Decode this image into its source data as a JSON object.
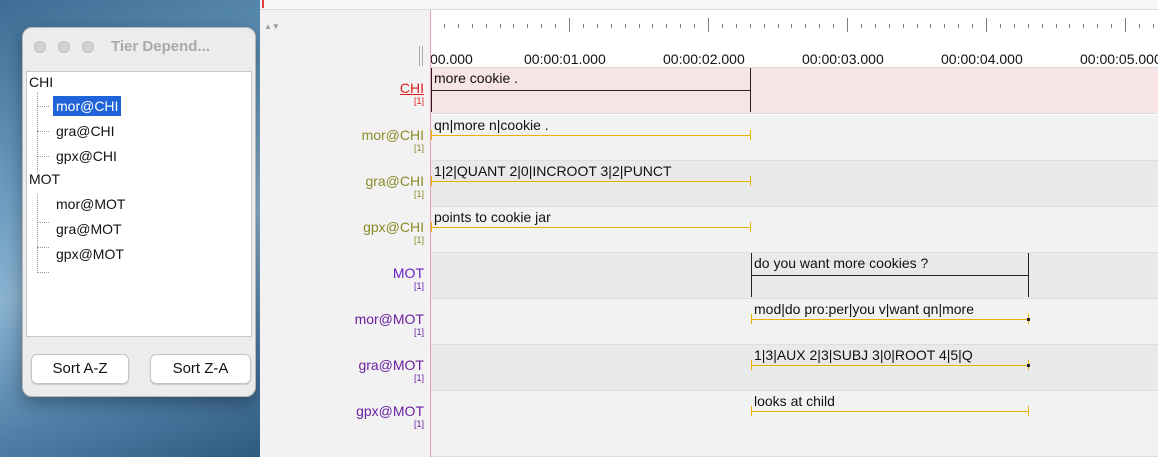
{
  "tier_dependency_window": {
    "title": "Tier Depend...",
    "tree": [
      {
        "label": "CHI",
        "level": 0,
        "selected": false
      },
      {
        "label": "mor@CHI",
        "level": 1,
        "selected": true
      },
      {
        "label": "gra@CHI",
        "level": 1,
        "selected": false
      },
      {
        "label": "gpx@CHI",
        "level": 1,
        "selected": false
      },
      {
        "label": "MOT",
        "level": 0,
        "selected": false
      },
      {
        "label": "mor@MOT",
        "level": 1,
        "selected": false
      },
      {
        "label": "gra@MOT",
        "level": 1,
        "selected": false
      },
      {
        "label": "gpx@MOT",
        "level": 1,
        "selected": false
      }
    ],
    "sort_az_label": "Sort A-Z",
    "sort_za_label": "Sort Z-A"
  },
  "timeline": {
    "ticks": [
      "00.000",
      "00:00:01.000",
      "00:00:02.000",
      "00:00:03.000",
      "00:00:04.000",
      "00:00:05.000"
    ]
  },
  "tiers": [
    {
      "name": "CHI",
      "index": "[1]",
      "color": "#e02020",
      "segments": [
        {
          "text": "more cookie ."
        }
      ]
    },
    {
      "name": "mor@CHI",
      "index": "[1]",
      "color": "#8a8a2a",
      "segments": [
        {
          "text": "qn|more n|cookie ."
        }
      ]
    },
    {
      "name": "gra@CHI",
      "index": "[1]",
      "color": "#8a8a2a",
      "segments": [
        {
          "text": "1|2|QUANT 2|0|INCROOT 3|2|PUNCT"
        }
      ]
    },
    {
      "name": "gpx@CHI",
      "index": "[1]",
      "color": "#8a8a2a",
      "segments": [
        {
          "text": "points to cookie jar"
        }
      ]
    },
    {
      "name": "MOT",
      "index": "[1]",
      "color": "#6a20c0",
      "segments": [
        {
          "text": "do you want more cookies ?"
        }
      ]
    },
    {
      "name": "mor@MOT",
      "index": "[1]",
      "color": "#6a20a0",
      "segments": [
        {
          "text": "mod|do pro:per|you v|want qn|more"
        }
      ]
    },
    {
      "name": "gra@MOT",
      "index": "[1]",
      "color": "#6a20a0",
      "segments": [
        {
          "text": "1|3|AUX 2|3|SUBJ 3|0|ROOT 4|5|Q"
        }
      ]
    },
    {
      "name": "gpx@MOT",
      "index": "[1]",
      "color": "#6a20a0",
      "segments": [
        {
          "text": "looks at child"
        }
      ]
    }
  ]
}
